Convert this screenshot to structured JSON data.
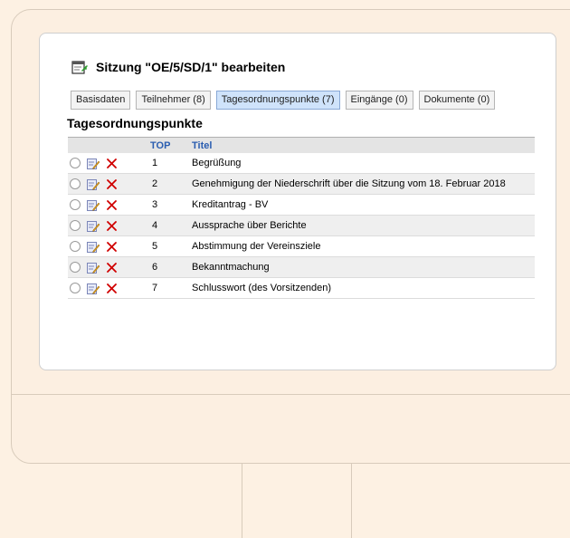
{
  "page": {
    "title": "Sitzung \"OE/5/SD/1\" bearbeiten",
    "section_title": "Tagesordnungspunkte"
  },
  "tabs": [
    {
      "label": "Basisdaten",
      "active": false
    },
    {
      "label": "Teilnehmer (8)",
      "active": false
    },
    {
      "label": "Tagesordnungspunkte (7)",
      "active": true
    },
    {
      "label": "Eingänge (0)",
      "active": false
    },
    {
      "label": "Dokumente (0)",
      "active": false
    }
  ],
  "table": {
    "headers": {
      "top": "TOP",
      "titel": "Titel"
    },
    "rows": [
      {
        "top": "1",
        "titel": "Begrüßung"
      },
      {
        "top": "2",
        "titel": "Genehmigung der Niederschrift über die Sitzung vom 18. Februar 2018"
      },
      {
        "top": "3",
        "titel": "Kreditantrag - BV"
      },
      {
        "top": "4",
        "titel": "Aussprache über Berichte"
      },
      {
        "top": "5",
        "titel": "Abstimmung der Vereinsziele"
      },
      {
        "top": "6",
        "titel": "Bekanntmachung"
      },
      {
        "top": "7",
        "titel": "Schlusswort (des Vorsitzenden)"
      }
    ]
  },
  "colors": {
    "accent": "#2a5db0",
    "delete": "#d00000",
    "active_tab": "#cfe3fb"
  },
  "icons": {
    "page": "edit-document-icon",
    "edit": "edit-icon",
    "delete": "delete-x-icon",
    "select": "radio-icon"
  }
}
